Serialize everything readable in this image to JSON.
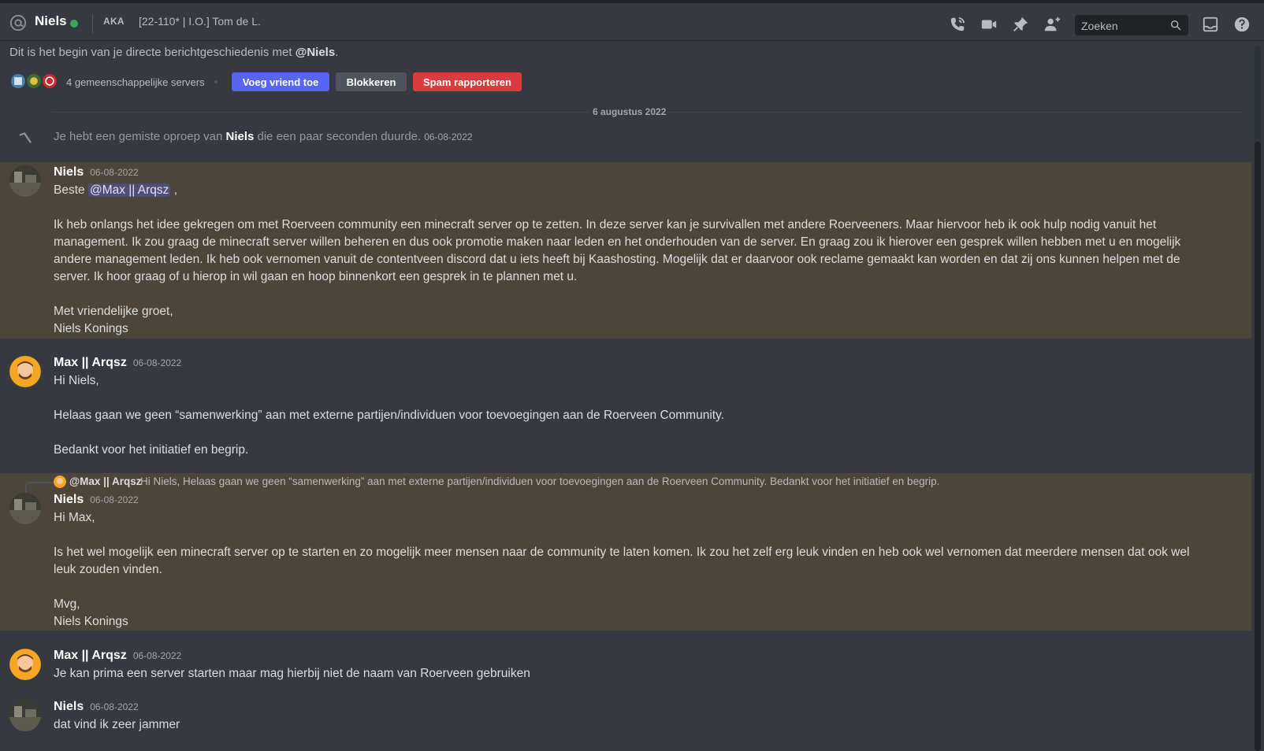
{
  "header": {
    "dm_name": "Niels",
    "aka_label": "AKA",
    "aka_names": "[22-110* | I.O.] Tom de L."
  },
  "search": {
    "placeholder": "Zoeken"
  },
  "intro": {
    "text": "Dit is het begin van je directe berichtgeschiedenis met ",
    "handle": "@Niels",
    "period": ".",
    "mutual_servers": "4 gemeenschappelijke servers",
    "add_friend": "Voeg vriend toe",
    "block": "Blokkeren",
    "report_spam": "Spam rapporteren"
  },
  "date_divider": "6 augustus 2022",
  "missed_call": {
    "prefix": "Je hebt een gemiste oproep van ",
    "name": "Niels",
    "suffix": " die een paar seconden duurde.",
    "timestamp": "06-08-2022"
  },
  "messages": [
    {
      "author": "Niels",
      "timestamp": "06-08-2022",
      "greeting_prefix": "Beste ",
      "mention": "@Max || Arqsz",
      "greeting_suffix": " ,",
      "body": "Ik heb onlangs het idee gekregen om met Roerveen community een minecraft server op te zetten. In deze server kan je survivallen met andere Roerveeners. Maar hiervoor heb ik ook hulp nodig vanuit het management. Ik zou graag de minecraft server willen beheren en dus ook promotie maken naar leden en het onderhouden van de server. En graag zou ik hierover een gesprek willen hebben met u en mogelijk andere management leden. Ik heb ook vernomen vanuit de contentveen discord dat u iets heeft bij Kaashosting. Mogelijk dat er daarvoor ook reclame gemaakt kan worden en dat zij ons kunnen helpen met de server. Ik hoor graag of u hierop in wil gaan en hoop binnenkort een gesprek in te plannen met u.",
      "closing": "Met vriendelijke groet,",
      "signature": "Niels Konings"
    },
    {
      "author": "Max || Arqsz",
      "timestamp": "06-08-2022",
      "line1": "Hi Niels,",
      "line2": "Helaas gaan we geen “samenwerking” aan met externe partijen/individuen voor toevoegingen aan de Roerveen Community.",
      "line3": "Bedankt voor het initiatief en begrip."
    },
    {
      "reply_author": "@Max || Arqsz",
      "reply_preview": "Hi Niels,  Helaas gaan we geen “samenwerking” aan met externe partijen/individuen voor toevoegingen aan de Roerveen Community.  Bedankt voor het initiatief en begrip.",
      "author": "Niels",
      "timestamp": "06-08-2022",
      "line1": "Hi Max,",
      "line2": "Is het wel mogelijk een minecraft server op te starten en zo mogelijk meer mensen naar de community te laten komen. Ik zou het zelf erg leuk vinden en heb ook wel vernomen dat meerdere mensen dat ook wel leuk zouden vinden.",
      "closing": "Mvg,",
      "signature": "Niels Konings"
    },
    {
      "author": "Max || Arqsz",
      "timestamp": "06-08-2022",
      "line1": "Je kan prima een server starten maar mag hierbij niet de naam van Roerveen gebruiken"
    },
    {
      "author": "Niels",
      "timestamp": "06-08-2022",
      "line1": "dat vind ik zeer jammer"
    }
  ],
  "colors": {
    "background": "#36393f",
    "highlight": "#4c453c",
    "blurple": "#5865f2",
    "danger": "#d83c3e",
    "online": "#3ba55d"
  }
}
